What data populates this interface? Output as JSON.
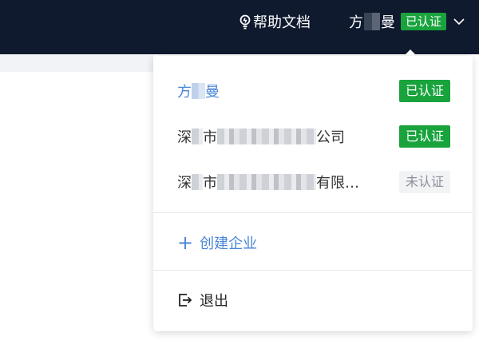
{
  "topbar": {
    "help_label": "帮助文档",
    "user_first": "方",
    "user_last": "曼",
    "user_badge": "已认证"
  },
  "dropdown": {
    "accounts": [
      {
        "prefix": "方",
        "suffix": "曼",
        "badge": "已认证",
        "status": "verified"
      },
      {
        "prefix": "深",
        "mid": "市",
        "suffix": "公司",
        "badge": "已认证",
        "status": "verified"
      },
      {
        "prefix": "深",
        "mid": "市",
        "suffix": "有限…",
        "badge": "未认证",
        "status": "unverified"
      }
    ],
    "create_label": "创建企业",
    "logout_label": "退出"
  },
  "colors": {
    "topbar_bg": "#0f1a2f",
    "verified_green": "#19a33d",
    "link_blue": "#4a86d8"
  }
}
